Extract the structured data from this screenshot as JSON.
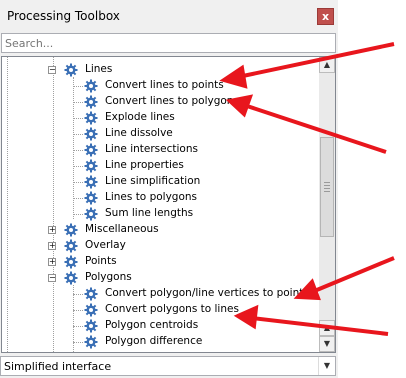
{
  "window": {
    "title": "Processing Toolbox",
    "close_glyph": "x"
  },
  "search": {
    "placeholder": "Search..."
  },
  "tree": {
    "groups": {
      "lines": "Lines",
      "miscellaneous": "Miscellaneous",
      "overlay": "Overlay",
      "points": "Points",
      "polygons": "Polygons"
    },
    "lines_items": [
      "Convert lines to points",
      "Convert lines to polygons",
      "Explode lines",
      "Line dissolve",
      "Line intersections",
      "Line properties",
      "Line simplification",
      "Lines to polygons",
      "Sum line lengths"
    ],
    "polygons_items": [
      "Convert polygon/line vertices to points",
      "Convert polygons to lines",
      "Polygon centroids",
      "Polygon difference"
    ]
  },
  "mode_select": {
    "value": "Simplified interface"
  },
  "colors": {
    "annotation_arrow": "#e8161d",
    "gear_icon": "#3a6fb5"
  }
}
